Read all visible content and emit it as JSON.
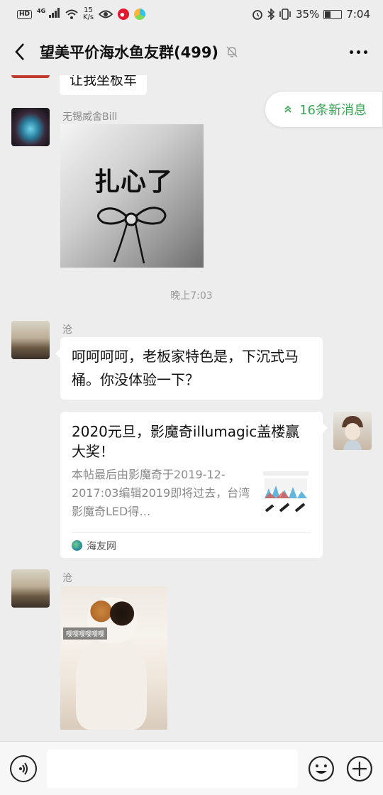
{
  "status_bar": {
    "hd_label": "HD",
    "network": "4G",
    "speed_top": "15",
    "speed_bottom": "K/s",
    "battery": "35%",
    "time": "7:04"
  },
  "header": {
    "title": "望美平价海水鱼友群(499)",
    "icons": [
      "back-icon",
      "mute-icon",
      "more-icon"
    ]
  },
  "chat": {
    "partial_message": "让我坐板车",
    "new_messages": "16条新消息",
    "messages": [
      {
        "sender": "无锡威舍Bill",
        "type": "sticker",
        "sticker_text": "扎心了"
      },
      {
        "type": "time",
        "text": "晚上7:03"
      },
      {
        "sender": "沧",
        "type": "text",
        "text": "呵呵呵呵，老板家特色是，下沉式马桶。你没体验一下？"
      },
      {
        "type": "link",
        "title": "2020元旦，影魔奇illumagic盖楼赢大奖！",
        "description": "本帖最后由影魔奇于2019-12-2017:03编辑2019即将过去，台湾影魔奇LED得…",
        "source": "海友网"
      },
      {
        "sender": "沧",
        "type": "sticker",
        "sticker_text": "嘤嘤嘤嘤嘤嘤"
      }
    ]
  },
  "input_bar": {
    "placeholder": "",
    "icons": [
      "voice-icon",
      "emoji-icon",
      "plus-icon"
    ]
  }
}
